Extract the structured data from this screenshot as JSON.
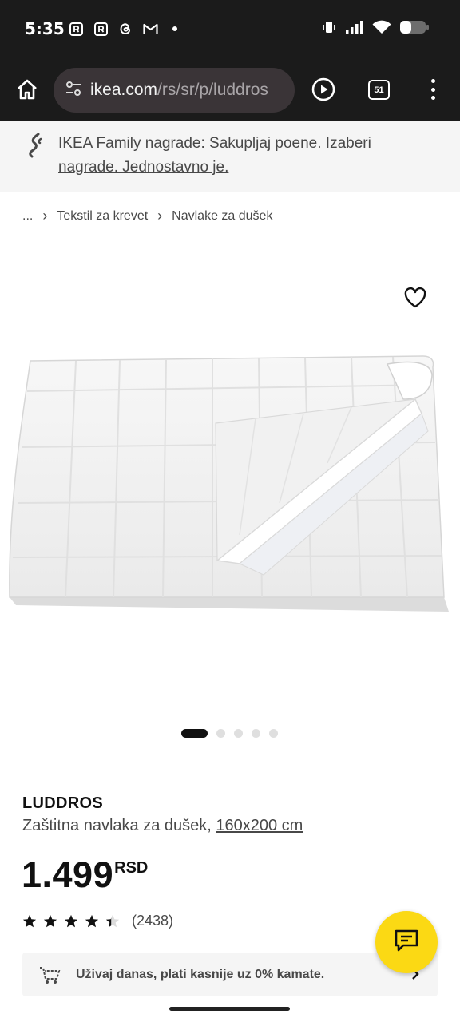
{
  "status_bar": {
    "time": "5:35",
    "notification_icons": [
      "r-app-icon",
      "r-app-icon",
      "threads-icon",
      "gmail-icon",
      "dot-icon"
    ],
    "system_icons": [
      "vibrate-icon",
      "signal-icon",
      "wifi-icon",
      "battery-icon"
    ]
  },
  "browser": {
    "url_domain": "ikea.com",
    "url_path": "/rs/sr/p/luddros",
    "tab_count": "51"
  },
  "promo": {
    "text": "IKEA Family nagrade: Sakupljaj poene. Izaberi nagrade. Jednostavno je."
  },
  "breadcrumb": {
    "items": [
      "...",
      "Tekstil za krevet",
      "Navlake za dušek"
    ]
  },
  "carousel": {
    "total": 5,
    "active_index": 0
  },
  "product": {
    "name": "LUDDROS",
    "description": "Zaštitna navlaka za dušek,",
    "size": "160x200 cm",
    "price": "1.499",
    "currency": "RSD",
    "rating": 4.3,
    "review_count": "(2438)"
  },
  "payment_banner": {
    "text": "Uživaj danas, plati kasnije uz 0% kamate."
  },
  "colors": {
    "system_bar": "#1b1b1b",
    "url_box": "#3a3437",
    "ikea_yellow": "#fbd914",
    "text_dark": "#111111",
    "text_gray": "#484848",
    "banner_bg": "#f5f5f5"
  }
}
